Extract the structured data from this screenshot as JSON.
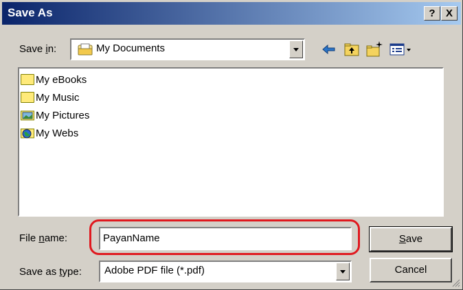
{
  "dialog": {
    "title": "Save As",
    "help_button": "?",
    "close_button": "X"
  },
  "save_in": {
    "label_prefix": "Save ",
    "label_underlined": "i",
    "label_suffix": "n:",
    "value": "My Documents",
    "icon": "my-documents-icon"
  },
  "toolbar": {
    "back_icon": "back-arrow-icon",
    "up_icon": "up-folder-icon",
    "new_folder_icon": "new-folder-icon",
    "views_icon": "views-menu-icon"
  },
  "files": [
    {
      "name": "My eBooks",
      "icon": "folder-icon"
    },
    {
      "name": "My Music",
      "icon": "folder-icon"
    },
    {
      "name": "My Pictures",
      "icon": "pictures-folder-icon"
    },
    {
      "name": "My Webs",
      "icon": "webs-folder-icon"
    }
  ],
  "file_name": {
    "label_prefix": "File ",
    "label_underlined": "n",
    "label_suffix": "ame:",
    "value": "PayanName"
  },
  "save_as_type": {
    "label_prefix": "Save as ",
    "label_underlined": "t",
    "label_suffix": "ype:",
    "value": "Adobe PDF file (*.pdf)"
  },
  "buttons": {
    "save_underlined": "S",
    "save_rest": "ave",
    "cancel": "Cancel"
  },
  "colors": {
    "annotation": "#e0181e",
    "title_start": "#0a246a",
    "title_end": "#a6caf0"
  }
}
